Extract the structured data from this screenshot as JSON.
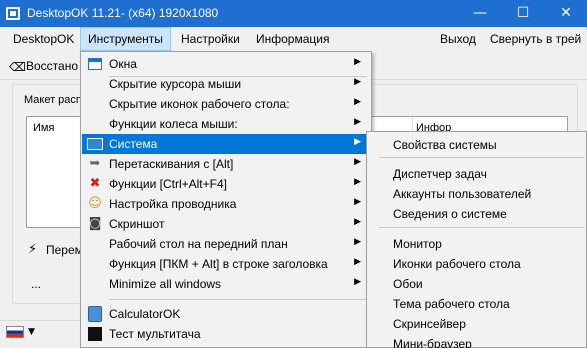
{
  "window": {
    "title": "DesktopOK 11.21- (x64) 1920x1080",
    "minimize_glyph": "—",
    "maximize_glyph": "☐",
    "close_glyph": "✕"
  },
  "menubar": {
    "items": [
      "DesktopOK",
      "Инструменты",
      "Настройки",
      "Информация"
    ],
    "right_items": [
      "Выход",
      "Свернуть в трей"
    ]
  },
  "toolbar": {
    "restore_label": "Восстано"
  },
  "main": {
    "group_label": "Макет расп",
    "columns": [
      "Имя",
      "Инфор"
    ],
    "perem_label": "Перем",
    "ellipsis": "..."
  },
  "dropdown": {
    "items": [
      {
        "label": "Окна",
        "icon": "window-icon",
        "arrow": true
      },
      {
        "label": "Скрытие курсора мыши",
        "icon": "",
        "arrow": true
      },
      {
        "label": "Скрытие иконок рабочего стола:",
        "icon": "",
        "arrow": true
      },
      {
        "label": "Функции колеса мыши:",
        "icon": "",
        "arrow": true
      },
      {
        "label": "Система",
        "icon": "system-icon",
        "arrow": true,
        "highlight": true
      },
      {
        "label": "Перетаскивания с [Alt]",
        "icon": "mouse-icon",
        "arrow": true
      },
      {
        "label": "Функции [Ctrl+Alt+F4]",
        "icon": "x-icon",
        "arrow": true
      },
      {
        "label": "Настройка проводника",
        "icon": "explorer-icon",
        "arrow": true
      },
      {
        "label": "Скриншот",
        "icon": "camera-icon",
        "arrow": true
      },
      {
        "label": "Рабочий стол на передний план",
        "icon": "",
        "arrow": true
      },
      {
        "label": "Функция [ПКМ + Alt] в строке заголовка",
        "icon": "",
        "arrow": true
      },
      {
        "label": "Minimize all windows",
        "icon": "",
        "arrow": true
      },
      {
        "label": "CalculatorOK",
        "icon": "calculator-icon",
        "arrow": false
      },
      {
        "label": "Тест мультитача",
        "icon": "terminal-icon",
        "arrow": false
      }
    ]
  },
  "submenu": {
    "items": [
      "Свойства системы",
      "Диспетчер задач",
      "Аккаунты пользователей",
      "Сведения о системе",
      "Монитор",
      "Иконки рабочего стола",
      "Обои",
      "Тема рабочего стола",
      "Скринсейвер",
      "Мини-браузер"
    ]
  },
  "colors": {
    "titlebar": "#1f6fd1",
    "highlight": "#0078d7",
    "menu_active": "#cce4f7"
  }
}
